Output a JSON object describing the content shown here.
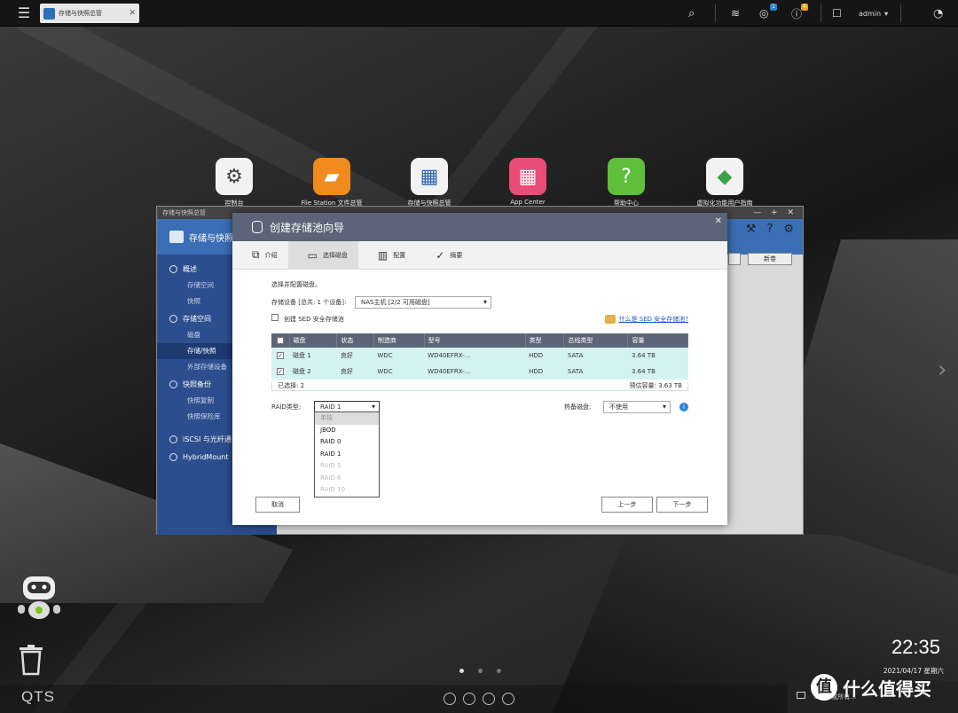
{
  "taskbar": {
    "app_tab": "存储与快照总管",
    "user": "admin",
    "notif_badge": "1",
    "info_badge": "4"
  },
  "desktop_icons": [
    {
      "label": "控制台",
      "icon": "gear-icon",
      "color": "#f2f2f2"
    },
    {
      "label": "File Station 文件总管",
      "icon": "folder-icon",
      "color": "#f08c1e"
    },
    {
      "label": "存储与快照总管",
      "icon": "storage-icon",
      "color": "#f2f2f2"
    },
    {
      "label": "App Center",
      "icon": "app-grid-icon",
      "color": "#e84c77"
    },
    {
      "label": "帮助中心",
      "icon": "question-icon",
      "color": "#5fbf3a"
    },
    {
      "label": "虚拟化功能用户指南",
      "icon": "cube-icon",
      "color": "#f2f2f2"
    }
  ],
  "bg_window": {
    "title": "存储与快照总管",
    "header": "存储与快照",
    "new_button": "新卷",
    "sidebar": [
      {
        "type": "group",
        "label": "概述"
      },
      {
        "type": "item",
        "label": "存储空间"
      },
      {
        "type": "item",
        "label": "快照"
      },
      {
        "type": "group",
        "label": "存储空间"
      },
      {
        "type": "item",
        "label": "磁盘"
      },
      {
        "type": "item",
        "label": "存储/快照",
        "selected": true
      },
      {
        "type": "item",
        "label": "外部存储设备"
      },
      {
        "type": "group",
        "label": "快照备份"
      },
      {
        "type": "item",
        "label": "快照复制"
      },
      {
        "type": "item",
        "label": "快照保险库"
      },
      {
        "type": "group",
        "label": "iSCSI 与光纤通"
      },
      {
        "type": "group",
        "label": "HybridMount"
      }
    ]
  },
  "dialog": {
    "title": "创建存储池向导",
    "steps": [
      "介绍",
      "选择磁盘",
      "配置",
      "摘要"
    ],
    "section_label": "选择并配置磁盘。",
    "device_label": "存储设备 [总共: 1 个设备]:",
    "device_value": "NAS主机 [2/2 可用磁盘]",
    "sed_checkbox": "创建 SED 安全存储池",
    "sed_link": "什么是 SED 安全存储池?",
    "columns": [
      "磁盘",
      "状态",
      "制造商",
      "型号",
      "类型",
      "总线类型",
      "容量"
    ],
    "rows": [
      [
        "磁盘 1",
        "良好",
        "WDC",
        "WD40EFRX-...",
        "HDD",
        "SATA",
        "3.64 TB"
      ],
      [
        "磁盘 2",
        "良好",
        "WDC",
        "WD40EFRX-...",
        "HDD",
        "SATA",
        "3.64 TB"
      ]
    ],
    "selected_count": "已选择: 2",
    "estimated": "预估容量: 3.63 TB",
    "raid_label": "RAID类型:",
    "raid_value": "RAID 1",
    "raid_options": [
      {
        "label": "单独",
        "state": "highlight"
      },
      {
        "label": "JBOD",
        "state": "enabled"
      },
      {
        "label": "RAID 0",
        "state": "enabled"
      },
      {
        "label": "RAID 1",
        "state": "enabled"
      },
      {
        "label": "RAID 5",
        "state": "disabled"
      },
      {
        "label": "RAID 6",
        "state": "disabled"
      },
      {
        "label": "RAID 10",
        "state": "disabled"
      }
    ],
    "spare_label": "热备磁盘:",
    "spare_value": "不使用",
    "cancel": "取消",
    "prev": "上一步",
    "next": "下一步"
  },
  "clock": {
    "time": "22:35",
    "date": "2021/04/17 星期六"
  },
  "brand": "QTS",
  "watermark": "什么值得买",
  "notice": "atter 或所有…"
}
